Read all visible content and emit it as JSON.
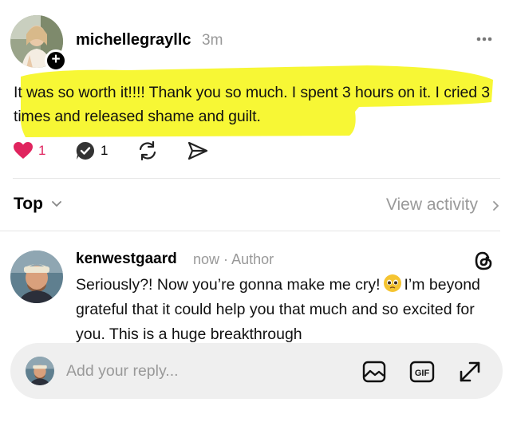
{
  "post": {
    "username": "michellegrayllc",
    "timestamp": "3m",
    "text": "It was so worth it!!!! Thank you so much. I spent 3 hours on it. I cried 3 times and released shame and guilt.",
    "like_count": "1",
    "reply_count": "1",
    "colors": {
      "like": "#e0245e",
      "highlight": "#f7f72a"
    }
  },
  "sort": {
    "label": "Top",
    "view_activity": "View activity"
  },
  "reply": {
    "username": "kenwestgaard",
    "time": "now",
    "separator": "·",
    "role": "Author",
    "text_before_emoji": "Seriously?! Now you’re gonna make me cry!",
    "emoji_icon": "pleading-face-emoji",
    "text_after_emoji": "I’m beyond grateful that it could help you that much and so excited for you. This is a huge breakthrough"
  },
  "composer": {
    "placeholder": "Add your reply...",
    "icons": [
      "image-icon",
      "gif-icon",
      "expand-icon"
    ]
  }
}
